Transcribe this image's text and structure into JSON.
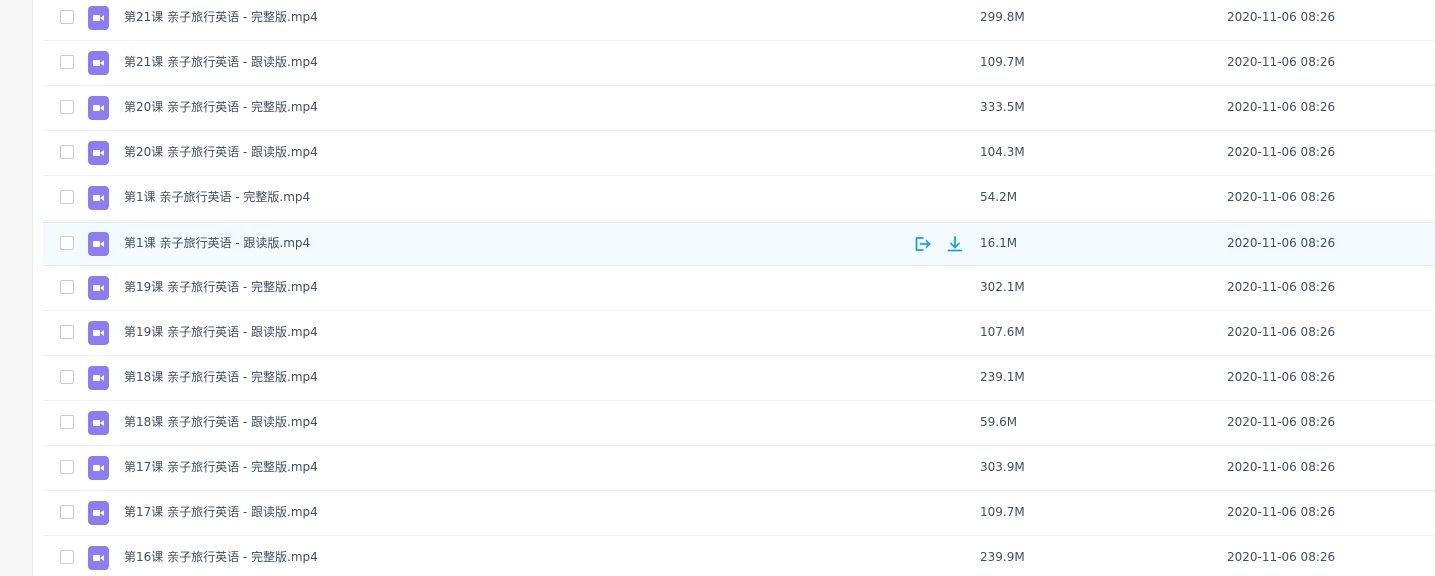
{
  "files": [
    {
      "name": "第21课 亲子旅行英语 - 完整版.mp4",
      "size": "299.8M",
      "modified": "2020-11-06 08:26",
      "icon": "video-file-icon"
    },
    {
      "name": "第21课 亲子旅行英语 - 跟读版.mp4",
      "size": "109.7M",
      "modified": "2020-11-06 08:26",
      "icon": "video-file-icon"
    },
    {
      "name": "第20课 亲子旅行英语 - 完整版.mp4",
      "size": "333.5M",
      "modified": "2020-11-06 08:26",
      "icon": "video-file-icon"
    },
    {
      "name": "第20课 亲子旅行英语 - 跟读版.mp4",
      "size": "104.3M",
      "modified": "2020-11-06 08:26",
      "icon": "video-file-icon"
    },
    {
      "name": "第1课 亲子旅行英语 - 完整版.mp4",
      "size": "54.2M",
      "modified": "2020-11-06 08:26",
      "icon": "video-file-icon"
    },
    {
      "name": "第1课 亲子旅行英语 - 跟读版.mp4",
      "size": "16.1M",
      "modified": "2020-11-06 08:26",
      "icon": "video-file-icon",
      "hovered": true
    },
    {
      "name": "第19课 亲子旅行英语 - 完整版.mp4",
      "size": "302.1M",
      "modified": "2020-11-06 08:26",
      "icon": "video-file-icon"
    },
    {
      "name": "第19课 亲子旅行英语 - 跟读版.mp4",
      "size": "107.6M",
      "modified": "2020-11-06 08:26",
      "icon": "video-file-icon"
    },
    {
      "name": "第18课 亲子旅行英语 - 完整版.mp4",
      "size": "239.1M",
      "modified": "2020-11-06 08:26",
      "icon": "video-file-icon"
    },
    {
      "name": "第18课 亲子旅行英语 - 跟读版.mp4",
      "size": "59.6M",
      "modified": "2020-11-06 08:26",
      "icon": "video-file-icon"
    },
    {
      "name": "第17课 亲子旅行英语 - 完整版.mp4",
      "size": "303.9M",
      "modified": "2020-11-06 08:26",
      "icon": "video-file-icon"
    },
    {
      "name": "第17课 亲子旅行英语 - 跟读版.mp4",
      "size": "109.7M",
      "modified": "2020-11-06 08:26",
      "icon": "video-file-icon"
    },
    {
      "name": "第16课 亲子旅行英语 - 完整版.mp4",
      "size": "239.9M",
      "modified": "2020-11-06 08:26",
      "icon": "video-file-icon"
    }
  ],
  "row_actions": [
    {
      "icon": "share-icon"
    },
    {
      "icon": "download-icon"
    }
  ],
  "colors": {
    "accent": "#1a9fe0",
    "video_icon": "#8e7cf2",
    "text": "#424e67",
    "hover_row": "#f4fbfe"
  }
}
